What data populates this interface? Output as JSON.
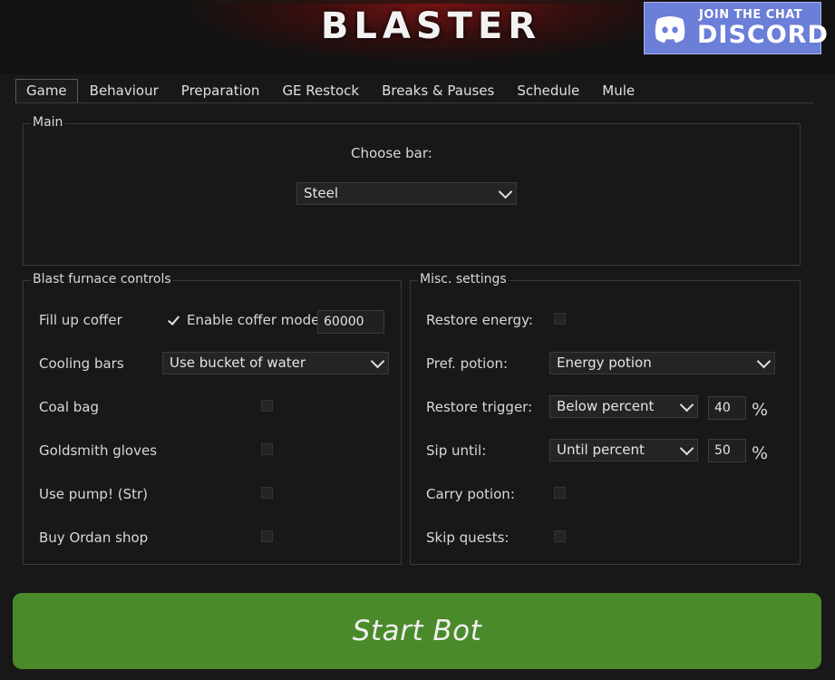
{
  "banner": {
    "title": "BLASTER",
    "discord_small": "JOIN THE CHAT",
    "discord_big": "DISCORD"
  },
  "tabs": [
    {
      "label": "Game",
      "active": true
    },
    {
      "label": "Behaviour"
    },
    {
      "label": "Preparation"
    },
    {
      "label": "GE Restock"
    },
    {
      "label": "Breaks & Pauses"
    },
    {
      "label": "Schedule"
    },
    {
      "label": "Mule"
    }
  ],
  "main": {
    "title": "Main",
    "choose_bar_label": "Choose bar:",
    "bar_value": "Steel"
  },
  "blast": {
    "title": "Blast furnace controls",
    "fill_coffer_label": "Fill up coffer",
    "coffer_mode_label": "Enable coffer mode",
    "coffer_mode_checked": true,
    "coffer_amount": "60000",
    "cooling_label": "Cooling bars",
    "cooling_value": "Use bucket of water",
    "coal_bag_label": "Coal bag",
    "coal_bag_checked": false,
    "gloves_label": "Goldsmith gloves",
    "gloves_checked": false,
    "pump_label": "Use pump! (Str)",
    "pump_checked": false,
    "ordan_label": "Buy Ordan shop",
    "ordan_checked": false
  },
  "misc": {
    "title": "Misc. settings",
    "restore_energy_label": "Restore energy:",
    "restore_energy_checked": false,
    "pref_potion_label": "Pref. potion:",
    "pref_potion_value": "Energy potion",
    "restore_trigger_label": "Restore trigger:",
    "restore_trigger_value": "Below percent",
    "restore_trigger_amount": "40",
    "sip_until_label": "Sip until:",
    "sip_until_value": "Until percent",
    "sip_until_amount": "50",
    "percent_sign": "%",
    "carry_potion_label": "Carry potion:",
    "carry_potion_checked": false,
    "skip_quests_label": "Skip quests:",
    "skip_quests_checked": false
  },
  "start_button": {
    "label": "Start Bot"
  },
  "colors": {
    "background": "#181818",
    "start_green": "#4a8a2a",
    "discord_blue": "#6b7ed8"
  }
}
